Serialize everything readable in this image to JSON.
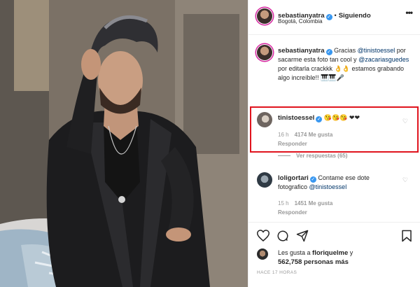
{
  "post": {
    "username": "sebastianyatra",
    "follow_label": "Siguiendo",
    "location": "Bogotá, Colombia"
  },
  "caption": {
    "username": "sebastianyatra",
    "text_1": "Gracias",
    "mention_1": "@tinistoessel",
    "text_2": " por sacarme esta foto tan cool y ",
    "mention_2": "@zacariasguedes",
    "text_3": " por editarla crackkk 👌👌 estamos grabando algo increíble!! 🎹🎹🎤"
  },
  "comments": [
    {
      "username": "tinistoessel",
      "text": "😘😘😘 ❤❤",
      "time": "16 h",
      "likes": "4174 Me gusta",
      "reply_label": "Responder",
      "view_replies": "Ver respuestas (65)"
    },
    {
      "username": "loligortari",
      "text": "Contame ese dote fotografico ",
      "mention": "@tinistoessel",
      "time": "15 h",
      "likes": "1451 Me gusta",
      "reply_label": "Responder"
    }
  ],
  "likes": {
    "text_1": "Les gusta a ",
    "user": "floriquelme",
    "text_2": " y ",
    "count": "562,758 personas más"
  },
  "timestamp": "HACE 17 HORAS",
  "icons": {
    "verified": "verified-badge-icon",
    "heart": "heart-icon",
    "comment": "comment-icon",
    "share": "share-icon",
    "bookmark": "bookmark-icon",
    "more": "more-options-icon"
  },
  "colors": {
    "verified": "#3897f0",
    "highlight_border": "#e0141e",
    "mention": "#003569",
    "muted": "#999999"
  }
}
